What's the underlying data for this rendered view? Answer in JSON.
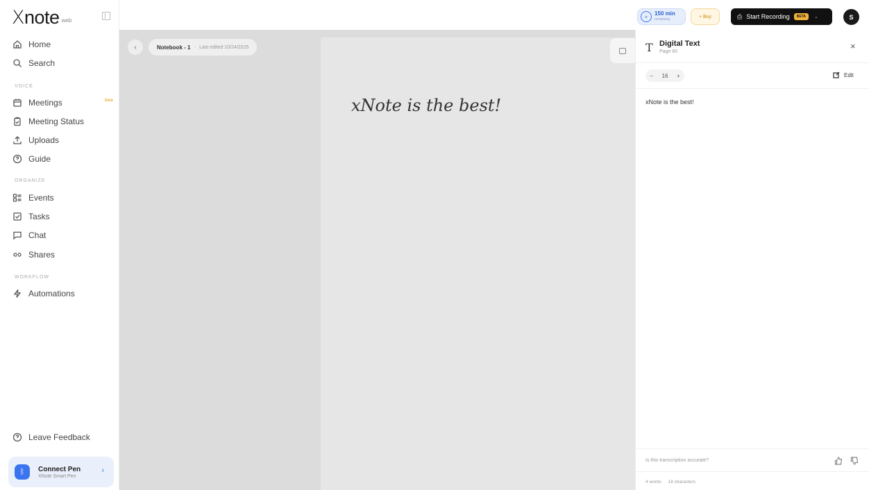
{
  "brand": {
    "name": "note",
    "tag": "web"
  },
  "nav": {
    "home": "Home",
    "search": "Search",
    "voice_label": "VOICE",
    "meetings": "Meetings",
    "meetings_badge": "beta",
    "meeting_status": "Meeting Status",
    "uploads": "Uploads",
    "guide": "Guide",
    "organize_label": "ORGANIZE",
    "events": "Events",
    "tasks": "Tasks",
    "chat": "Chat",
    "shares": "Shares",
    "workflow_label": "WORKFLOW",
    "automations": "Automations",
    "leave_feedback": "Leave Feedback"
  },
  "connect": {
    "title": "Connect Pen",
    "subtitle": "XNote Smart Pen"
  },
  "breadcrumb": {
    "notebook": "Notebook - 1",
    "edited": "Last edited 10/24/2025"
  },
  "handwriting": "xNote is the best!",
  "topbar": {
    "minutes_value": "150 min",
    "minutes_sub": "remaining",
    "buy_label": "+ Buy",
    "record_label": "Start Recording",
    "record_badge": "BETA",
    "avatar_initial": "S"
  },
  "panel": {
    "title": "Digital Text",
    "page": "Page 60",
    "font_size": "16",
    "font_minus": "−",
    "font_plus": "+",
    "edit_label": "Edit",
    "transcription": "xNote is the best!",
    "feedback_question": "Is this transcription accurate?",
    "words": "4 words",
    "characters": "18 characters"
  },
  "colors": {
    "accent": "#3b74f0",
    "record_bg": "#111111",
    "beta": "#f2b33a",
    "canvas": "#dcdcdc"
  }
}
